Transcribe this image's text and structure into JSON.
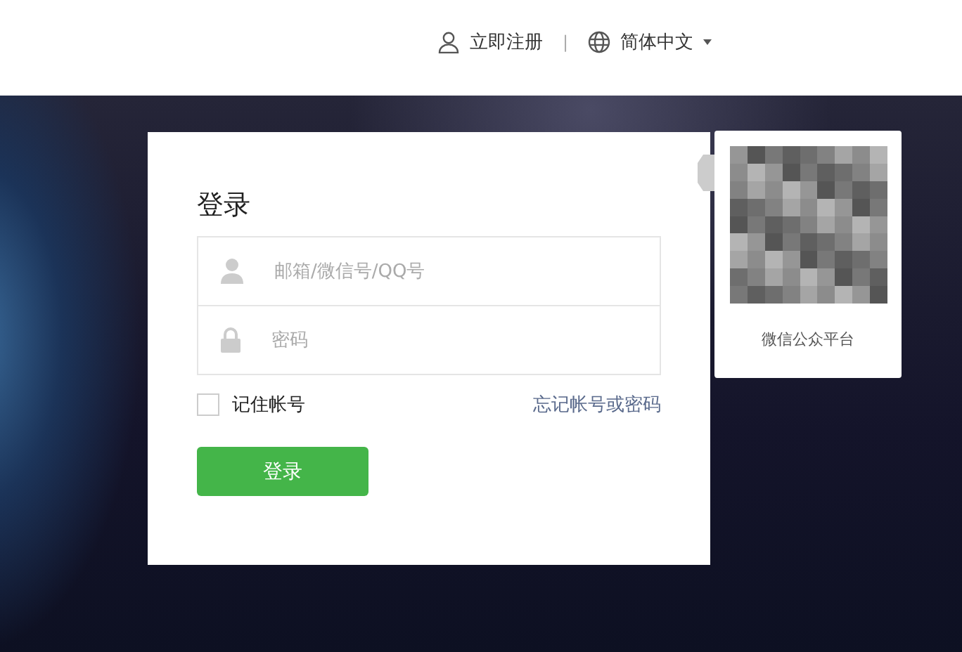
{
  "header": {
    "register_link": "立即注册",
    "separator": "|",
    "language_menu": "简体中文"
  },
  "login": {
    "title": "登录",
    "account_field": {
      "placeholder": "邮箱/微信号/QQ号"
    },
    "password_field": {
      "placeholder": "密码"
    },
    "remember": {
      "label": "记住帐号",
      "checked": false
    },
    "forgot_link": "忘记帐号或密码",
    "submit": "登录"
  },
  "qr_card": {
    "caption": "微信公众平台"
  }
}
